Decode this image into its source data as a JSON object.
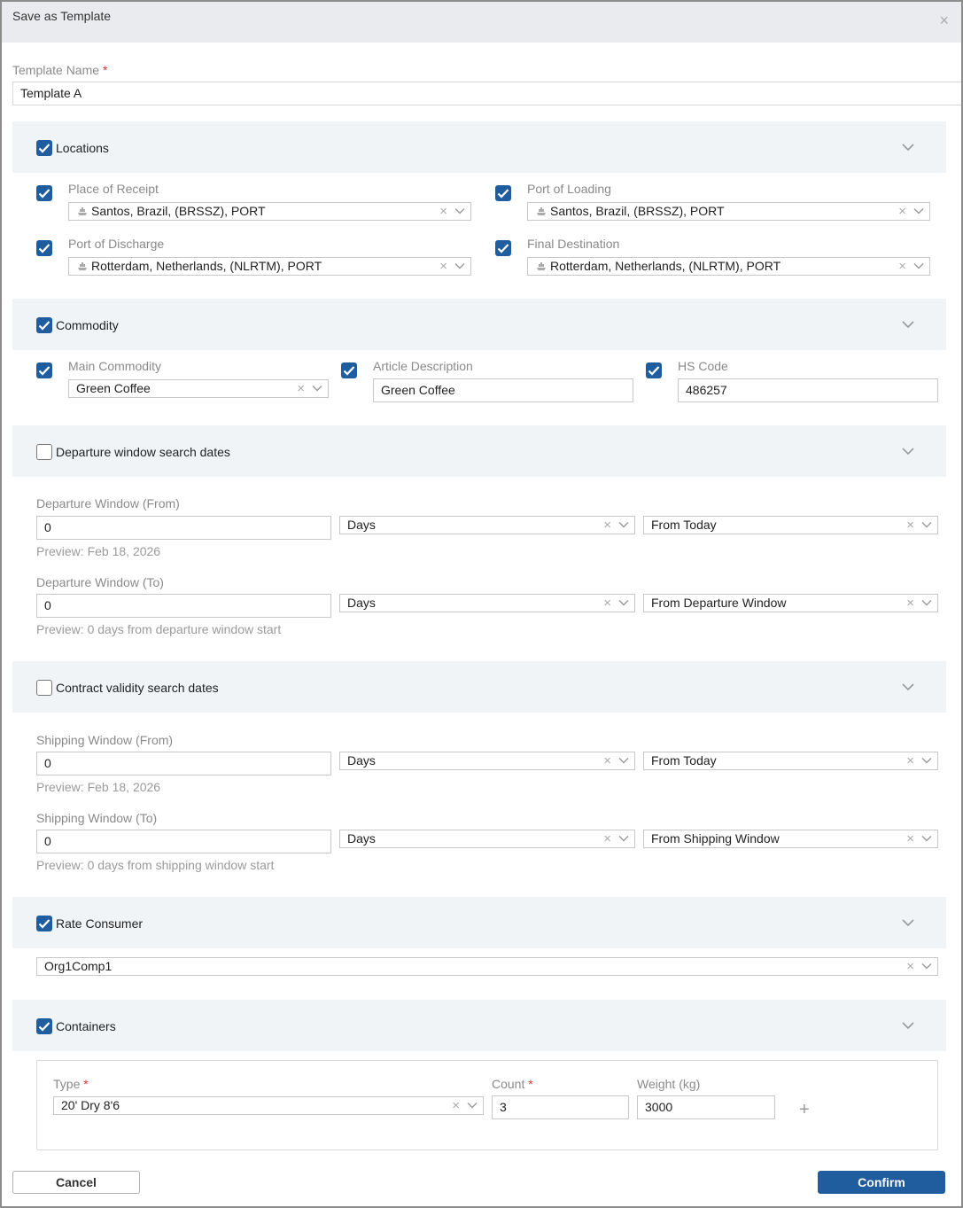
{
  "dialog": {
    "title": "Save as Template",
    "close": "×"
  },
  "template_name": {
    "label": "Template Name",
    "required": "*",
    "value": "Template A"
  },
  "locations": {
    "title": "Locations",
    "checked": true,
    "place_of_receipt": {
      "label": "Place of Receipt",
      "value": "Santos, Brazil, (BRSSZ), PORT"
    },
    "port_of_loading": {
      "label": "Port of Loading",
      "value": "Santos, Brazil, (BRSSZ), PORT"
    },
    "port_of_discharge": {
      "label": "Port of Discharge",
      "value": "Rotterdam, Netherlands, (NLRTM), PORT"
    },
    "final_destination": {
      "label": "Final Destination",
      "value": "Rotterdam, Netherlands, (NLRTM), PORT"
    }
  },
  "commodity": {
    "title": "Commodity",
    "checked": true,
    "main_commodity": {
      "label": "Main Commodity",
      "value": "Green Coffee"
    },
    "article_description": {
      "label": "Article Description",
      "value": "Green Coffee"
    },
    "hs_code": {
      "label": "HS Code",
      "value": "486257"
    }
  },
  "departure": {
    "title": "Departure window search dates",
    "checked": false,
    "from": {
      "label": "Departure Window (From)",
      "value": "0",
      "unit": "Days",
      "reference": "From Today",
      "preview": "Preview: Feb 18, 2026"
    },
    "to": {
      "label": "Departure Window (To)",
      "value": "0",
      "unit": "Days",
      "reference": "From Departure Window",
      "preview": "Preview: 0 days from departure window start"
    }
  },
  "contract": {
    "title": "Contract validity search dates",
    "checked": false,
    "from": {
      "label": "Shipping Window (From)",
      "value": "0",
      "unit": "Days",
      "reference": "From Today",
      "preview": "Preview: Feb 18, 2026"
    },
    "to": {
      "label": "Shipping Window (To)",
      "value": "0",
      "unit": "Days",
      "reference": "From Shipping Window",
      "preview": "Preview: 0 days from shipping window start"
    }
  },
  "rate_consumer": {
    "title": "Rate Consumer",
    "checked": true,
    "value": "Org1Comp1"
  },
  "containers": {
    "title": "Containers",
    "checked": true,
    "type": {
      "label": "Type",
      "required": "*",
      "value": "20' Dry 8'6"
    },
    "count": {
      "label": "Count",
      "required": "*",
      "value": "3"
    },
    "weight": {
      "label": "Weight (kg)",
      "value": "3000"
    },
    "add": "+"
  },
  "actions": {
    "cancel": "Cancel",
    "confirm": "Confirm"
  },
  "icons": {
    "clear": "×",
    "chevron": "chevron-down-icon",
    "check": "check-icon",
    "ship": "ship-icon"
  },
  "colors": {
    "accent": "#1f5d9e",
    "section_bg": "#f1f4f7",
    "header_bg": "#e9ebee",
    "required": "#e03131"
  }
}
